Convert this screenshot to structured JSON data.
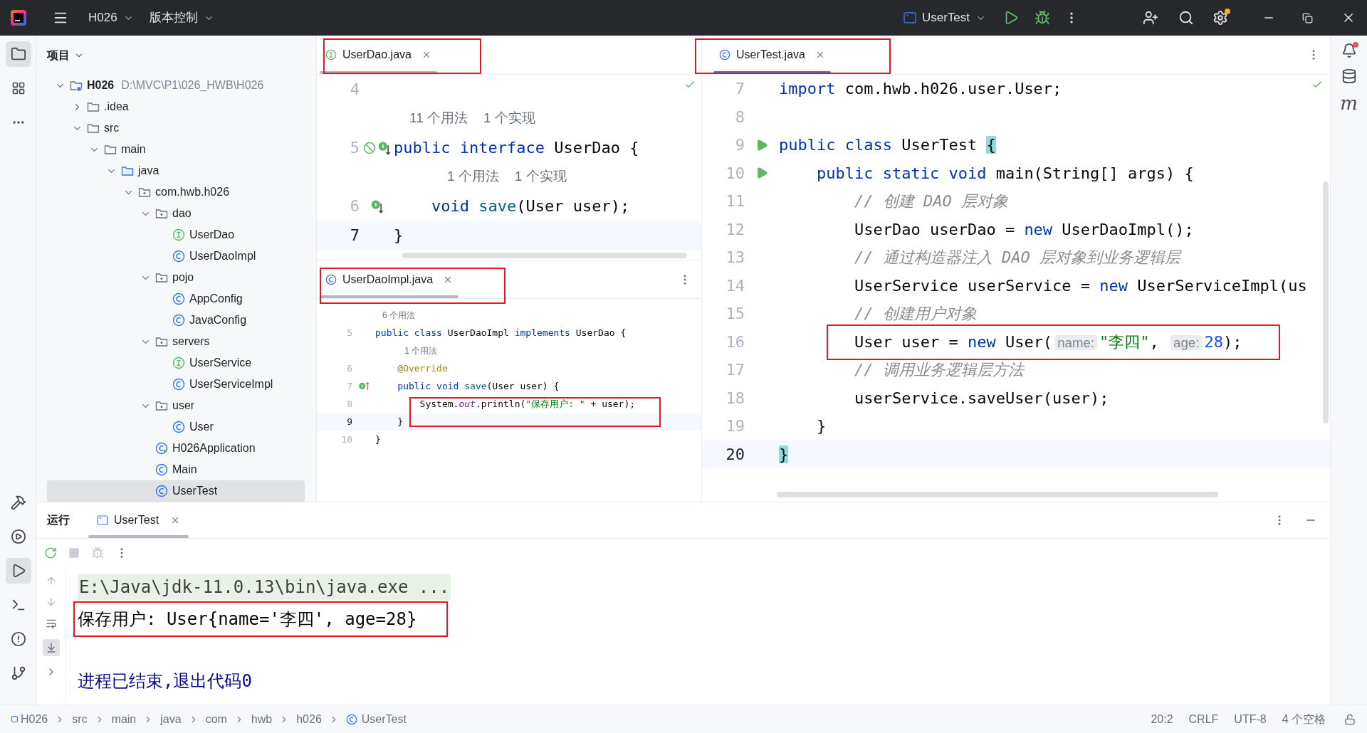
{
  "title_bar": {
    "project": "H026",
    "vcs": "版本控制",
    "run_config": "UserTest"
  },
  "project_panel": {
    "title": "项目",
    "tree": [
      {
        "name": "H026",
        "path": "D:\\MVC\\P1\\026_HWB\\H026",
        "kind": "module",
        "expanded": true,
        "selected": false,
        "children": [
          {
            "name": ".idea",
            "kind": "folder",
            "expanded": false,
            "selected": false
          },
          {
            "name": "src",
            "kind": "folder",
            "expanded": true,
            "selected": false,
            "children": [
              {
                "name": "main",
                "kind": "folder",
                "expanded": true,
                "selected": false,
                "children": [
                  {
                    "name": "java",
                    "kind": "source",
                    "expanded": true,
                    "selected": false,
                    "children": [
                      {
                        "name": "com.hwb.h026",
                        "kind": "package",
                        "expanded": true,
                        "selected": false,
                        "children": [
                          {
                            "name": "dao",
                            "kind": "package",
                            "expanded": true,
                            "selected": false,
                            "children": [
                              {
                                "name": "UserDao",
                                "kind": "interface",
                                "selected": false
                              },
                              {
                                "name": "UserDaoImpl",
                                "kind": "class",
                                "selected": false
                              }
                            ]
                          },
                          {
                            "name": "pojo",
                            "kind": "package",
                            "expanded": true,
                            "selected": false,
                            "children": [
                              {
                                "name": "AppConfig",
                                "kind": "class",
                                "selected": false
                              },
                              {
                                "name": "JavaConfig",
                                "kind": "class",
                                "selected": false
                              }
                            ]
                          },
                          {
                            "name": "servers",
                            "kind": "package",
                            "expanded": true,
                            "selected": false,
                            "children": [
                              {
                                "name": "UserService",
                                "kind": "interface",
                                "selected": false
                              },
                              {
                                "name": "UserServiceImpl",
                                "kind": "class",
                                "selected": false
                              }
                            ]
                          },
                          {
                            "name": "user",
                            "kind": "package",
                            "expanded": true,
                            "selected": false,
                            "children": [
                              {
                                "name": "User",
                                "kind": "class",
                                "selected": false
                              }
                            ]
                          },
                          {
                            "name": "H026Application",
                            "kind": "app",
                            "selected": false
                          },
                          {
                            "name": "Main",
                            "kind": "class",
                            "selected": false
                          },
                          {
                            "name": "UserTest",
                            "kind": "class",
                            "selected": true
                          }
                        ]
                      }
                    ]
                  }
                ]
              }
            ]
          }
        ]
      }
    ]
  },
  "editor_top_left": {
    "tab": {
      "label": "UserDao.java",
      "kind": "interface",
      "selected": false
    },
    "lines": [
      {
        "kind": "code",
        "number": "4",
        "current": false
      },
      {
        "kind": "hint",
        "items": [
          "11 个用法",
          "1 个实现"
        ]
      },
      {
        "kind": "code",
        "number": "5",
        "current": false,
        "gutter": [
          {
            "kind": "suppressed"
          },
          {
            "kind": "implemented"
          }
        ],
        "tokens": [
          {
            "kind": "keyword",
            "text": "public interface "
          },
          {
            "kind": "plain",
            "text": "UserDao {"
          }
        ]
      },
      {
        "kind": "hint",
        "items": [
          "1 个用法",
          "1 个实现"
        ]
      },
      {
        "kind": "code",
        "number": "6",
        "current": false,
        "gutter": [
          {
            "kind": "implemented"
          }
        ],
        "tokens": [
          {
            "kind": "keyword",
            "text": "    void "
          },
          {
            "kind": "method",
            "text": "save"
          },
          {
            "kind": "plain",
            "text": "(User user);"
          }
        ]
      },
      {
        "kind": "code",
        "number": "7",
        "current": true,
        "tokens": [
          {
            "kind": "plain",
            "text": "}"
          }
        ]
      }
    ]
  },
  "editor_bottom_left": {
    "tab": {
      "label": "UserDaoImpl.java",
      "kind": "class",
      "selected": false
    },
    "lines": [
      {
        "kind": "hint",
        "items": [
          "6 个用法"
        ]
      },
      {
        "kind": "code",
        "number": "5",
        "current": false,
        "tokens": [
          {
            "kind": "keyword",
            "text": "public class "
          },
          {
            "kind": "plain",
            "text": "UserDaoImpl "
          },
          {
            "kind": "keyword",
            "text": "implements "
          },
          {
            "kind": "plain",
            "text": "UserDao {"
          }
        ]
      },
      {
        "kind": "hint",
        "items": [
          "1 个用法"
        ]
      },
      {
        "kind": "code",
        "number": "6",
        "current": false,
        "tokens": [
          {
            "kind": "annotation",
            "text": "    @Override"
          }
        ]
      },
      {
        "kind": "code",
        "number": "7",
        "current": false,
        "gutter": [
          {
            "kind": "implements"
          }
        ],
        "tokens": [
          {
            "kind": "keyword",
            "text": "    public void "
          },
          {
            "kind": "method",
            "text": "save"
          },
          {
            "kind": "plain",
            "text": "(User user) {"
          }
        ]
      },
      {
        "kind": "code",
        "number": "8",
        "current": false,
        "tokens": [
          {
            "kind": "plain",
            "text": "        System."
          },
          {
            "kind": "field",
            "text": "out"
          },
          {
            "kind": "plain",
            "text": ".println("
          },
          {
            "kind": "string",
            "text": "\"保存用户: \""
          },
          {
            "kind": "plain",
            "text": " + user);"
          }
        ]
      },
      {
        "kind": "code",
        "number": "9",
        "current": true,
        "tokens": [
          {
            "kind": "plain",
            "text": "    }"
          }
        ]
      },
      {
        "kind": "code",
        "number": "10",
        "current": false,
        "tokens": [
          {
            "kind": "plain",
            "text": "}"
          }
        ]
      }
    ]
  },
  "editor_right": {
    "tab": {
      "label": "UserTest.java",
      "kind": "class",
      "selected": true
    },
    "lines": [
      {
        "kind": "code",
        "number": "7",
        "current": false,
        "tokens": [
          {
            "kind": "keyword",
            "text": "import "
          },
          {
            "kind": "plain",
            "text": "com.hwb.h026.user.User;"
          }
        ]
      },
      {
        "kind": "code",
        "number": "8",
        "current": false
      },
      {
        "kind": "code",
        "number": "9",
        "current": false,
        "gutter": [
          {
            "kind": "run"
          }
        ],
        "tokens": [
          {
            "kind": "keyword",
            "text": "public class "
          },
          {
            "kind": "plain",
            "text": "UserTest "
          },
          {
            "kind": "brace",
            "text": "{"
          }
        ]
      },
      {
        "kind": "code",
        "number": "10",
        "current": false,
        "gutter": [
          {
            "kind": "run"
          }
        ],
        "tokens": [
          {
            "kind": "keyword",
            "text": "    public static void "
          },
          {
            "kind": "plain",
            "text": "main(String[] args) {"
          }
        ]
      },
      {
        "kind": "code",
        "number": "11",
        "current": false,
        "tokens": [
          {
            "kind": "comment",
            "text": "        // 创建 DAO 层对象"
          }
        ]
      },
      {
        "kind": "code",
        "number": "12",
        "current": false,
        "tokens": [
          {
            "kind": "plain",
            "text": "        UserDao userDao = "
          },
          {
            "kind": "keyword",
            "text": "new "
          },
          {
            "kind": "plain",
            "text": "UserDaoImpl();"
          }
        ]
      },
      {
        "kind": "code",
        "number": "13",
        "current": false,
        "tokens": [
          {
            "kind": "comment",
            "text": "        // 通过构造器注入 DAO 层对象到业务逻辑层"
          }
        ]
      },
      {
        "kind": "code",
        "number": "14",
        "current": false,
        "tokens": [
          {
            "kind": "plain",
            "text": "        UserService userService = "
          },
          {
            "kind": "keyword",
            "text": "new "
          },
          {
            "kind": "plain",
            "text": "UserServiceImpl(us"
          }
        ]
      },
      {
        "kind": "code",
        "number": "15",
        "current": false,
        "tokens": [
          {
            "kind": "comment",
            "text": "        // 创建用户对象"
          }
        ]
      },
      {
        "kind": "code",
        "number": "16",
        "current": false,
        "tokens": [
          {
            "kind": "plain",
            "text": "        User user = "
          },
          {
            "kind": "keyword",
            "text": "new "
          },
          {
            "kind": "plain",
            "text": "User("
          },
          {
            "kind": "inlay",
            "text": "name:"
          },
          {
            "kind": "string",
            "text": "\"李四\""
          },
          {
            "kind": "plain",
            "text": ", "
          },
          {
            "kind": "inlay",
            "text": "age:"
          },
          {
            "kind": "number",
            "text": "28"
          },
          {
            "kind": "plain",
            "text": ");"
          }
        ]
      },
      {
        "kind": "code",
        "number": "17",
        "current": false,
        "tokens": [
          {
            "kind": "comment",
            "text": "        // 调用业务逻辑层方法"
          }
        ]
      },
      {
        "kind": "code",
        "number": "18",
        "current": false,
        "tokens": [
          {
            "kind": "plain",
            "text": "        userService.saveUser(user);"
          }
        ]
      },
      {
        "kind": "code",
        "number": "19",
        "current": false,
        "tokens": [
          {
            "kind": "plain",
            "text": "    }"
          }
        ]
      },
      {
        "kind": "code",
        "number": "20",
        "current": true,
        "tokens": [
          {
            "kind": "brace",
            "text": "}"
          }
        ]
      }
    ]
  },
  "run_panel": {
    "title": "运行",
    "tab": {
      "label": "UserTest",
      "selected": true
    },
    "console": [
      {
        "kind": "command",
        "text": "E:\\Java\\jdk-11.0.13\\bin\\java.exe ..."
      },
      {
        "kind": "output",
        "text": "保存用户: User{name='李四', age=28}"
      },
      {
        "kind": "exit",
        "text": "进程已结束,退出代码0"
      }
    ]
  },
  "right_strip": {
    "maven_label": "m"
  },
  "status_bar": {
    "breadcrumbs": [
      "H026",
      "src",
      "main",
      "java",
      "com",
      "hwb",
      "h026",
      "UserTest"
    ],
    "items": [
      "20:2",
      "CRLF",
      "UTF-8",
      "4 个空格"
    ]
  }
}
